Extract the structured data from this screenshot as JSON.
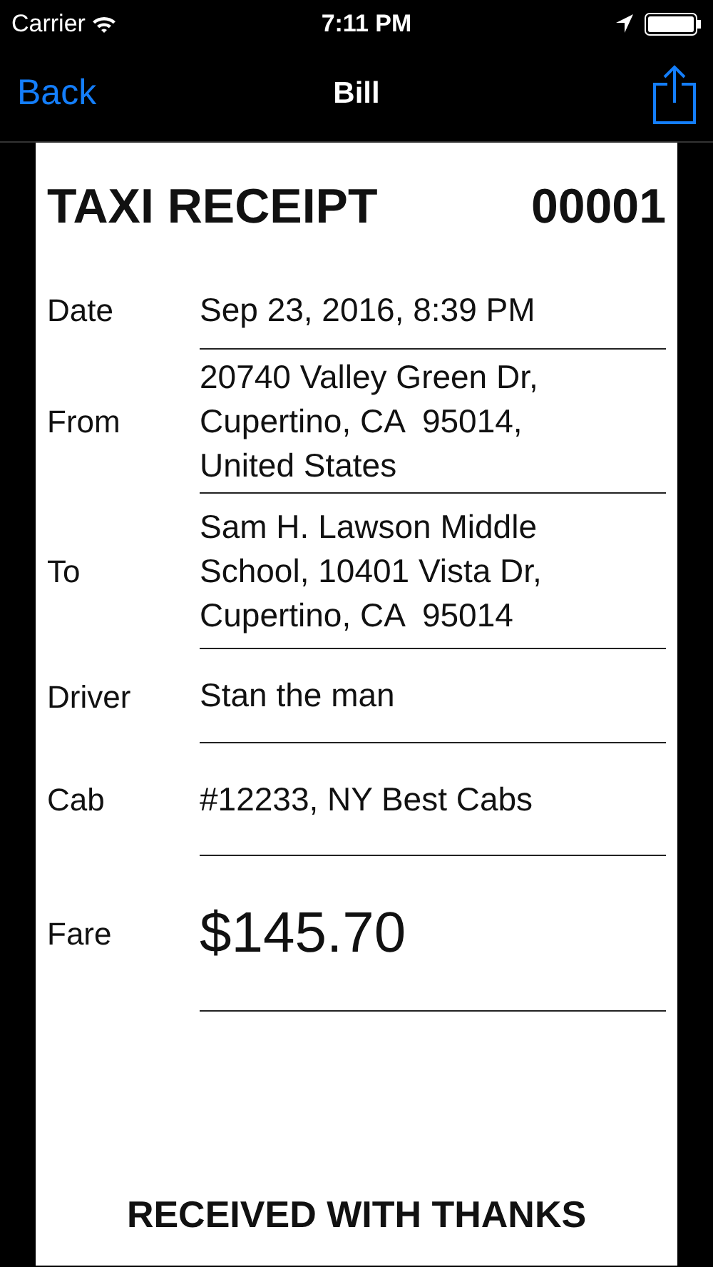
{
  "status_bar": {
    "carrier": "Carrier",
    "time": "7:11 PM"
  },
  "nav_bar": {
    "back": "Back",
    "title": "Bill"
  },
  "receipt": {
    "title": "TAXI RECEIPT",
    "number": "00001",
    "fields": [
      {
        "label": "Date",
        "value": "Sep 23, 2016, 8:39 PM",
        "kind": "normal"
      },
      {
        "label": "From",
        "value": "20740 Valley Green Dr,\nCupertino, CA  95014,\nUnited States",
        "kind": "normal"
      },
      {
        "label": "To",
        "value": "Sam H. Lawson Middle\nSchool, 10401 Vista Dr,\nCupertino, CA  95014",
        "kind": "normal"
      },
      {
        "label": "Driver",
        "value": "Stan the man",
        "kind": "normal"
      },
      {
        "label": "Cab",
        "value": "#12233, NY Best Cabs",
        "kind": "normal"
      },
      {
        "label": "Fare",
        "value": "$145.70",
        "kind": "total"
      }
    ],
    "footer": "RECEIVED WITH THANKS"
  }
}
